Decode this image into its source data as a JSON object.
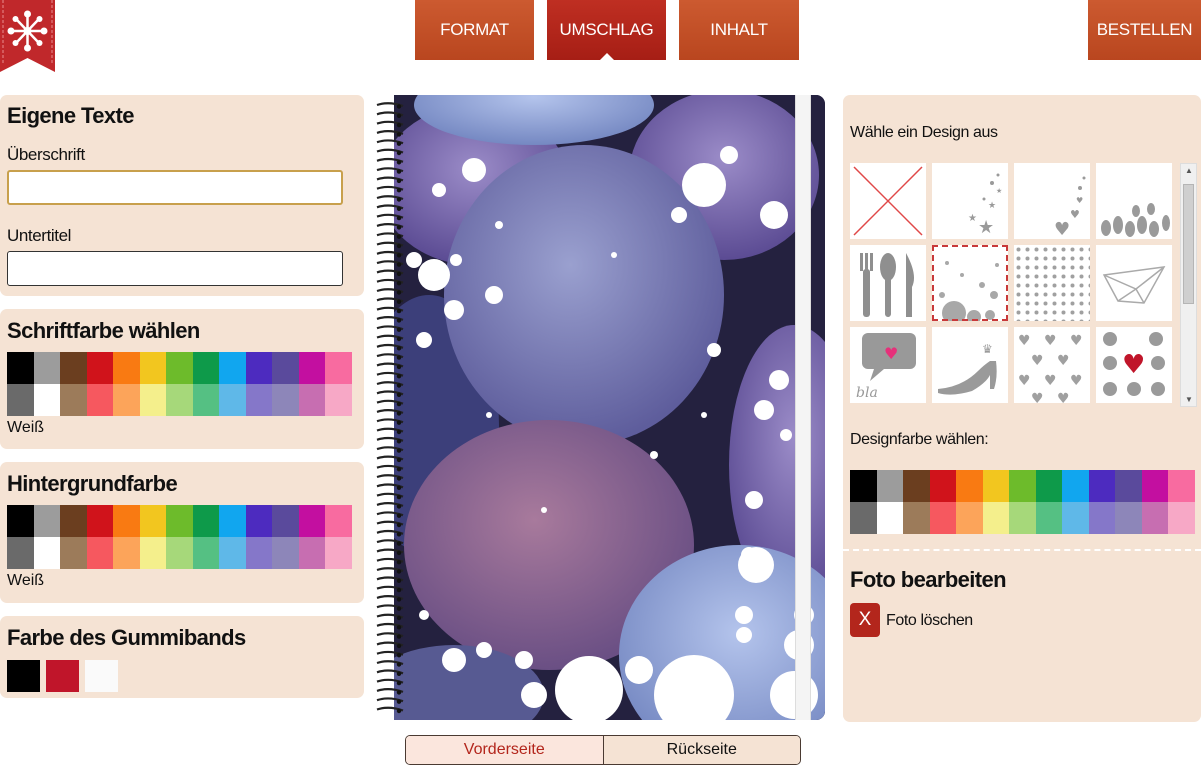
{
  "nav": {
    "tabs": [
      {
        "label": "FORMAT"
      },
      {
        "label": "UMSCHLAG"
      },
      {
        "label": "INHALT"
      }
    ],
    "order_label": "BESTELLEN",
    "active_tab": "UMSCHLAG"
  },
  "left": {
    "texts": {
      "title": "Eigene Texte",
      "heading_label": "Überschrift",
      "heading_value": "",
      "subtitle_label": "Untertitel",
      "subtitle_value": ""
    },
    "font_color": {
      "title": "Schriftfarbe wählen",
      "current": "Weiß"
    },
    "background_color": {
      "title": "Hintergrundfarbe",
      "current": "Weiß"
    },
    "band_color": {
      "title": "Farbe des Gummibands",
      "options": [
        "#000000",
        "#c0152a",
        "#fafafa"
      ]
    }
  },
  "palette": [
    "#000000",
    "#9c9c9c",
    "#6b3e1f",
    "#d0131b",
    "#f97a12",
    "#f2c61f",
    "#6dbb2b",
    "#0e9a4a",
    "#11a6ef",
    "#4d2bbf",
    "#5a4a9c",
    "#c30fa0",
    "#f86ba0",
    "#6a6a6a",
    "#ffffff",
    "#9c7b5a",
    "#f6585f",
    "#fca45a",
    "#f4ef8c",
    "#a6d87a",
    "#55c083",
    "#5fb8e8",
    "#8577c9",
    "#8d86b9",
    "#c76eb1",
    "#f7a8c6"
  ],
  "preview": {
    "front_label": "Vorderseite",
    "back_label": "Rückseite"
  },
  "right": {
    "design_title": "Wähle ein Design aus",
    "design_tiles": [
      "kein Design",
      "Sterne",
      "Herzen",
      "Blätter",
      "Besteck",
      "Spritzer",
      "Punkte",
      "Papierboot",
      "Sprechblase bla",
      "Schuh",
      "Herzchen",
      "Herz Punkte"
    ],
    "design_selected": "Spritzer",
    "design_color_title": "Designfarbe wählen:",
    "photo_title": "Foto bearbeiten",
    "delete_icon_label": "X",
    "delete_label": "Foto löschen"
  }
}
